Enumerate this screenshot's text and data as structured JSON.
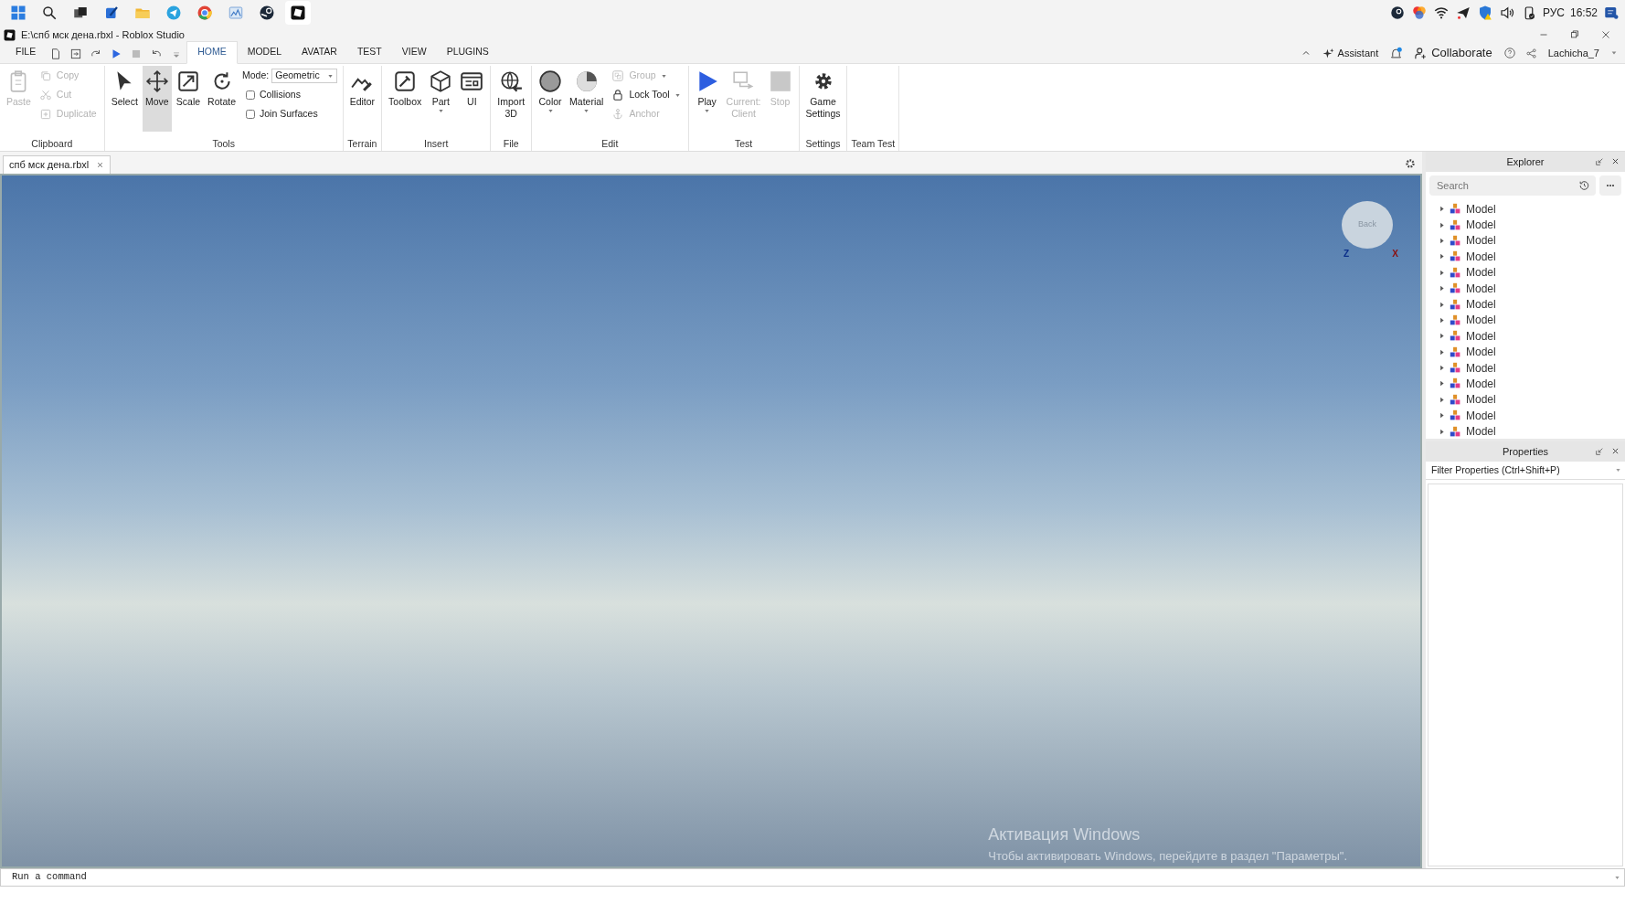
{
  "taskbar": {
    "language": "РУС",
    "time": "16:52"
  },
  "window": {
    "title": "E:\\спб мск дена.rbxl - Roblox Studio"
  },
  "menu": {
    "file": "FILE",
    "tabs": [
      {
        "label": "HOME",
        "selected": true
      },
      {
        "label": "MODEL",
        "selected": false
      },
      {
        "label": "AVATAR",
        "selected": false
      },
      {
        "label": "TEST",
        "selected": false
      },
      {
        "label": "VIEW",
        "selected": false
      },
      {
        "label": "PLUGINS",
        "selected": false
      }
    ],
    "assistant": "Assistant",
    "collaborate": "Collaborate",
    "user": "Lachicha_7"
  },
  "ribbon": {
    "groups": [
      {
        "label": "Clipboard",
        "items": [
          {
            "kind": "large",
            "label": "Paste",
            "disabled": true,
            "dropdown": false,
            "selected": false
          },
          {
            "kind": "small",
            "label": "Copy",
            "disabled": true,
            "dropdown": false
          },
          {
            "kind": "small",
            "label": "Cut",
            "disabled": true,
            "dropdown": false
          },
          {
            "kind": "small",
            "label": "Duplicate",
            "disabled": true,
            "dropdown": false
          }
        ]
      },
      {
        "label": "Tools",
        "items": [
          {
            "kind": "large",
            "label": "Select",
            "disabled": false,
            "dropdown": false,
            "selected": false
          },
          {
            "kind": "large",
            "label": "Move",
            "disabled": false,
            "dropdown": false,
            "selected": true
          },
          {
            "kind": "large",
            "label": "Scale",
            "disabled": false,
            "dropdown": false,
            "selected": false
          },
          {
            "kind": "large",
            "label": "Rotate",
            "disabled": false,
            "dropdown": false,
            "selected": false
          },
          {
            "kind": "select",
            "label": "Mode:",
            "value": "Geometric"
          },
          {
            "kind": "checkbox",
            "label": "Collisions",
            "checked": false
          },
          {
            "kind": "checkbox",
            "label": "Join Surfaces",
            "checked": false
          }
        ]
      },
      {
        "label": "Terrain",
        "items": [
          {
            "kind": "large",
            "label": "Editor",
            "disabled": false,
            "dropdown": false,
            "selected": false
          }
        ]
      },
      {
        "label": "Insert",
        "items": [
          {
            "kind": "large",
            "label": "Toolbox",
            "disabled": false,
            "dropdown": false,
            "selected": false
          },
          {
            "kind": "large",
            "label": "Part",
            "disabled": false,
            "dropdown": true,
            "selected": false
          },
          {
            "kind": "large",
            "label": "UI",
            "disabled": false,
            "dropdown": false,
            "selected": false
          }
        ]
      },
      {
        "label": "File",
        "items": [
          {
            "kind": "large",
            "label": "Import\n3D",
            "disabled": false,
            "dropdown": false,
            "selected": false
          }
        ]
      },
      {
        "label": "Edit",
        "items": [
          {
            "kind": "large",
            "label": "Color",
            "disabled": false,
            "dropdown": true,
            "selected": false
          },
          {
            "kind": "large",
            "label": "Material",
            "disabled": false,
            "dropdown": true,
            "selected": false
          },
          {
            "kind": "small",
            "label": "Group",
            "disabled": true,
            "dropdown": true
          },
          {
            "kind": "small",
            "label": "Lock Tool",
            "disabled": false,
            "dropdown": true
          },
          {
            "kind": "small",
            "label": "Anchor",
            "disabled": true,
            "dropdown": false
          }
        ]
      },
      {
        "label": "Test",
        "items": [
          {
            "kind": "large",
            "label": "Play",
            "disabled": false,
            "dropdown": true,
            "selected": false
          },
          {
            "kind": "large",
            "label": "Current:\nClient",
            "disabled": true,
            "dropdown": false,
            "selected": false
          },
          {
            "kind": "large",
            "label": "Stop",
            "disabled": true,
            "dropdown": false,
            "selected": false
          }
        ]
      },
      {
        "label": "Settings",
        "items": [
          {
            "kind": "large",
            "label": "Game\nSettings",
            "disabled": false,
            "dropdown": false,
            "selected": false
          }
        ]
      },
      {
        "label": "Team Test"
      }
    ]
  },
  "document_tab": {
    "label": "спб мск дена.rbxl",
    "selected": true
  },
  "viewport": {
    "view_cube": {
      "face": "Back",
      "axes": [
        "Z",
        "X"
      ]
    },
    "activation_notice": {
      "title": "Активация Windows",
      "text": "Чтобы активировать Windows, перейдите в раздел \"Параметры\"."
    }
  },
  "explorer": {
    "title": "Explorer",
    "search": {
      "placeholder": "Search"
    },
    "items": [
      {
        "label": "Model",
        "expanded": false
      },
      {
        "label": "Model",
        "expanded": false
      },
      {
        "label": "Model",
        "expanded": false
      },
      {
        "label": "Model",
        "expanded": false
      },
      {
        "label": "Model",
        "expanded": false
      },
      {
        "label": "Model",
        "expanded": false
      },
      {
        "label": "Model",
        "expanded": false
      },
      {
        "label": "Model",
        "expanded": false
      },
      {
        "label": "Model",
        "expanded": false
      },
      {
        "label": "Model",
        "expanded": false
      },
      {
        "label": "Model",
        "expanded": false
      },
      {
        "label": "Model",
        "expanded": false
      },
      {
        "label": "Model",
        "expanded": false
      },
      {
        "label": "Model",
        "expanded": false
      },
      {
        "label": "Model",
        "expanded": false
      }
    ]
  },
  "properties": {
    "title": "Properties",
    "filter": {
      "placeholder": "Filter Properties (Ctrl+Shift+P)"
    }
  },
  "command_bar": {
    "placeholder": "Run a command"
  }
}
